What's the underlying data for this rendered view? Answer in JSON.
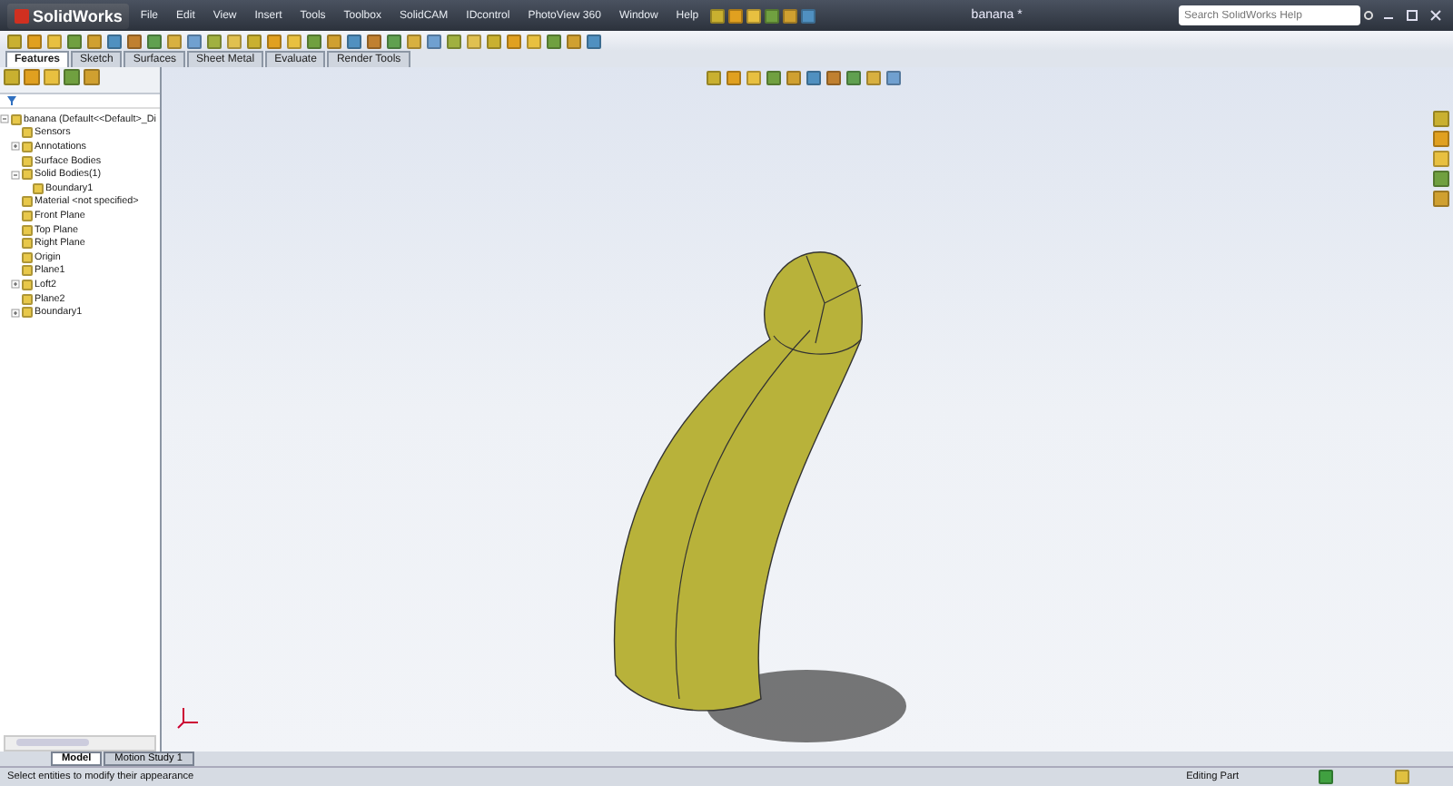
{
  "app": {
    "logo": "SolidWorks",
    "menu": [
      "File",
      "Edit",
      "View",
      "Insert",
      "Tools",
      "Toolbox",
      "SolidCAM",
      "IDcontrol",
      "PhotoView 360",
      "Window",
      "Help"
    ],
    "title": "banana *",
    "search": {
      "placeholder": "Search SolidWorks Help"
    }
  },
  "command_tabs": [
    {
      "label": "Features",
      "selected": true
    },
    {
      "label": "Sketch",
      "selected": false
    },
    {
      "label": "Surfaces",
      "selected": false
    },
    {
      "label": "Sheet Metal",
      "selected": false
    },
    {
      "label": "Evaluate",
      "selected": false
    },
    {
      "label": "Render Tools",
      "selected": false
    }
  ],
  "tree": [
    {
      "label": "banana  (Default<<Default>_Di",
      "expanded": true,
      "children": [
        {
          "label": "Sensors"
        },
        {
          "label": "Annotations",
          "expanded": false
        },
        {
          "label": "Surface Bodies"
        },
        {
          "label": "Solid Bodies(1)",
          "expanded": true,
          "children": [
            {
              "label": "Boundary1"
            }
          ]
        },
        {
          "label": "Material <not specified>"
        },
        {
          "label": "Front Plane"
        },
        {
          "label": "Top Plane"
        },
        {
          "label": "Right Plane"
        },
        {
          "label": "Origin"
        },
        {
          "label": "Plane1"
        },
        {
          "label": "Loft2",
          "expanded": false
        },
        {
          "label": "Plane2"
        },
        {
          "label": "Boundary1",
          "expanded": false
        }
      ]
    }
  ],
  "bottom_tabs": [
    {
      "label": "Model",
      "selected": true
    },
    {
      "label": "Motion Study 1",
      "selected": false
    }
  ],
  "status_bar": {
    "message": "Select entities to modify their appearance",
    "mode": "Editing Part"
  }
}
